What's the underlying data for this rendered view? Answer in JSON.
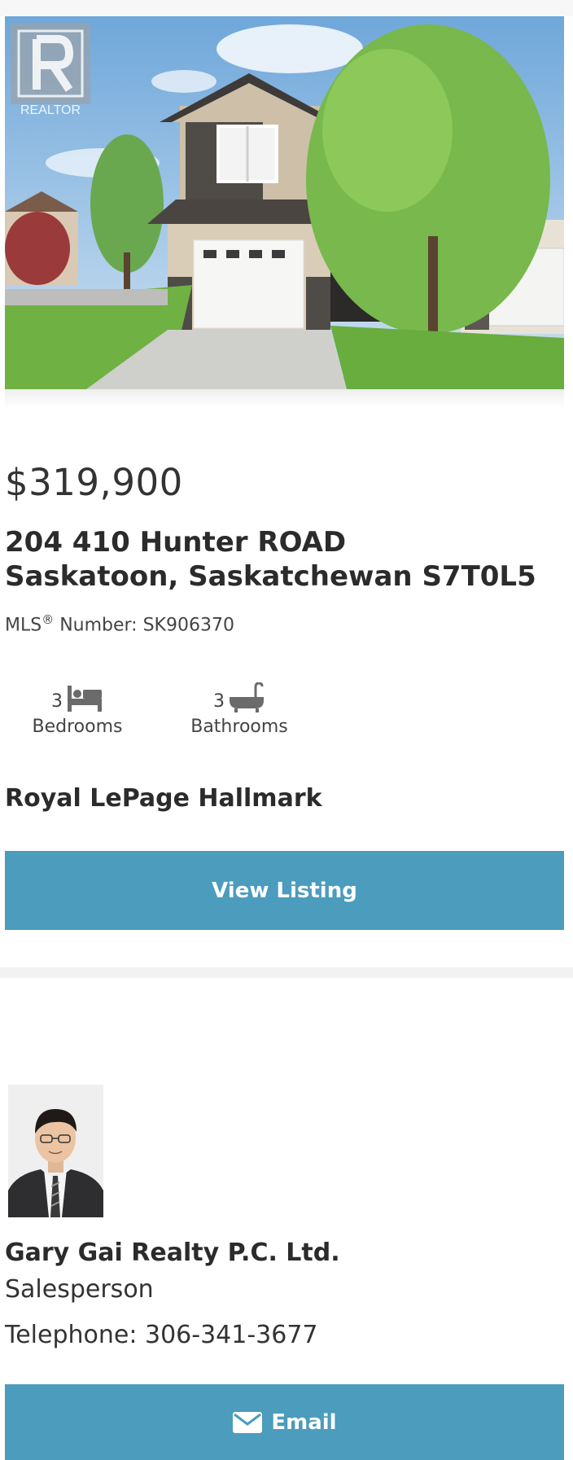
{
  "listing": {
    "image_alt": "Listing photo of townhouse",
    "badge_text": "REALTOR",
    "price": "$319,900",
    "address_line1": "204 410 Hunter ROAD",
    "address_line2": "Saskatoon, Saskatchewan S7T0L5",
    "mls_prefix": "MLS",
    "mls_reg": "®",
    "mls_suffix": " Number: SK906370",
    "bedrooms": {
      "count": "3",
      "label": "Bedrooms",
      "icon": "bed-icon"
    },
    "bathrooms": {
      "count": "3",
      "label": "Bathrooms",
      "icon": "bathtub-icon"
    },
    "brokerage": "Royal LePage Hallmark",
    "view_button": "View Listing"
  },
  "agent": {
    "name": "Gary Gai Realty P.C. Ltd.",
    "role": "Salesperson",
    "phone": "Telephone: 306-341-3677",
    "email_button": "Email",
    "email_icon": "envelope-icon"
  },
  "colors": {
    "button_bg": "#4b9cbd",
    "button_text": "#ffffff",
    "divider": "#f2f2f2"
  }
}
